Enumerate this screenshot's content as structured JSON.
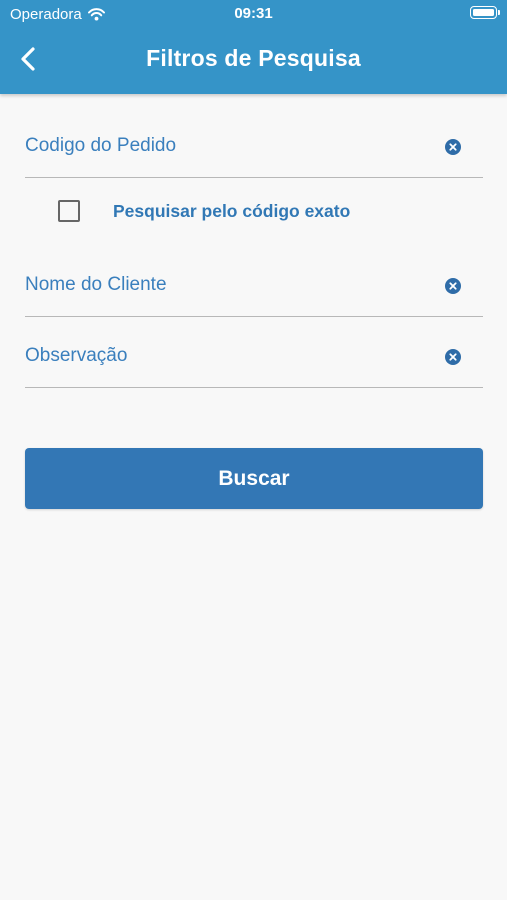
{
  "status_bar": {
    "carrier": "Operadora",
    "time": "09:31"
  },
  "nav": {
    "title": "Filtros de Pesquisa",
    "back_icon": "chevron-left-icon"
  },
  "form": {
    "order_code": {
      "placeholder": "Codigo do Pedido",
      "value": ""
    },
    "exact_code": {
      "label": "Pesquisar pelo código exato",
      "checked": false
    },
    "client_name": {
      "placeholder": "Nome do Cliente",
      "value": ""
    },
    "observation": {
      "placeholder": "Observação",
      "value": ""
    },
    "clear_icon": "clear-circle-icon",
    "search_label": "Buscar"
  },
  "colors": {
    "header": "#3594c8",
    "accent": "#3377b5",
    "field_text": "#3a7fbd",
    "background": "#f8f8f8",
    "divider": "#b8b8b8"
  }
}
